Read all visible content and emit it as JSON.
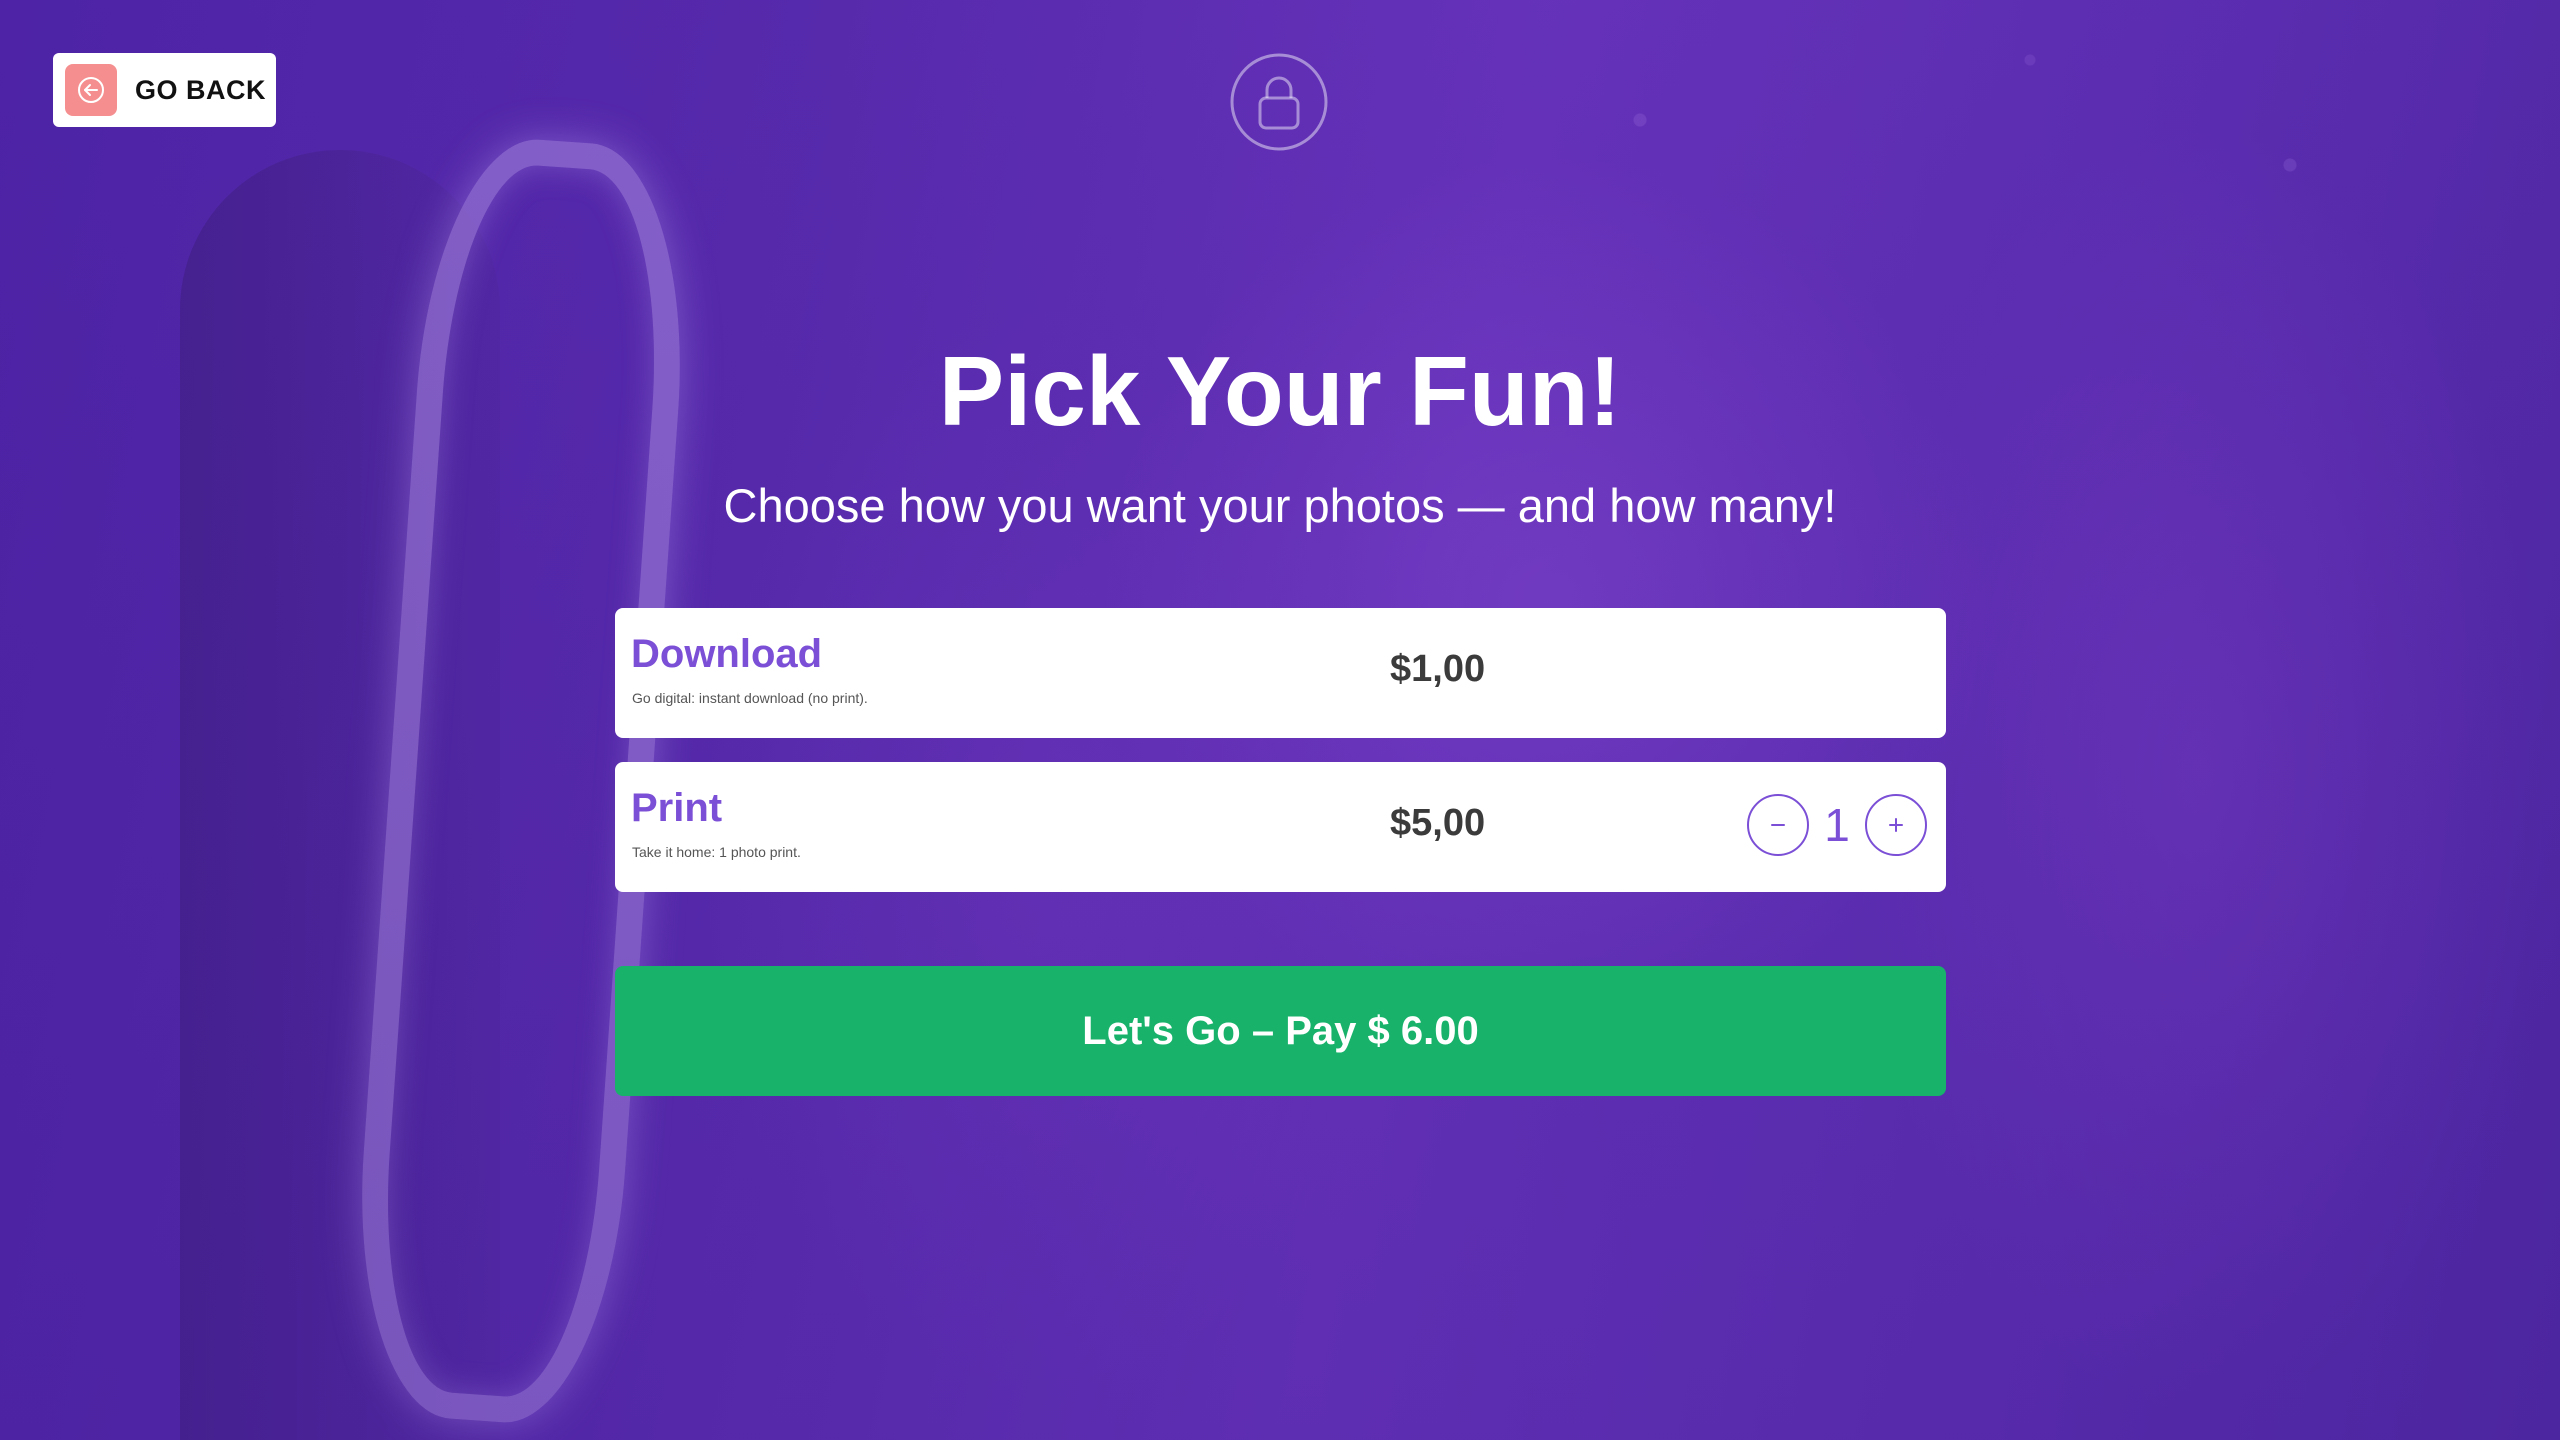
{
  "nav": {
    "back_label": "GO BACK"
  },
  "header": {
    "title": "Pick Your Fun!",
    "subtitle": "Choose how you want your photos — and how many!"
  },
  "options": [
    {
      "name": "Download",
      "description": "Go digital: instant download (no print).",
      "price": "$1,00"
    },
    {
      "name": "Print",
      "description": "Take it home: 1 photo print.",
      "price": "$5,00",
      "quantity": "1"
    }
  ],
  "pay_button": {
    "label": "Let's Go – Pay $ 6.00"
  },
  "icons": {
    "back": "arrow-left-circle-icon",
    "lock": "lock-icon",
    "minus": "minus-icon",
    "plus": "plus-icon"
  },
  "colors": {
    "background": "#5a2cb0",
    "accent": "#7b4fd6",
    "pay": "#18b26b",
    "back_icon_bg": "#f58f8f"
  }
}
